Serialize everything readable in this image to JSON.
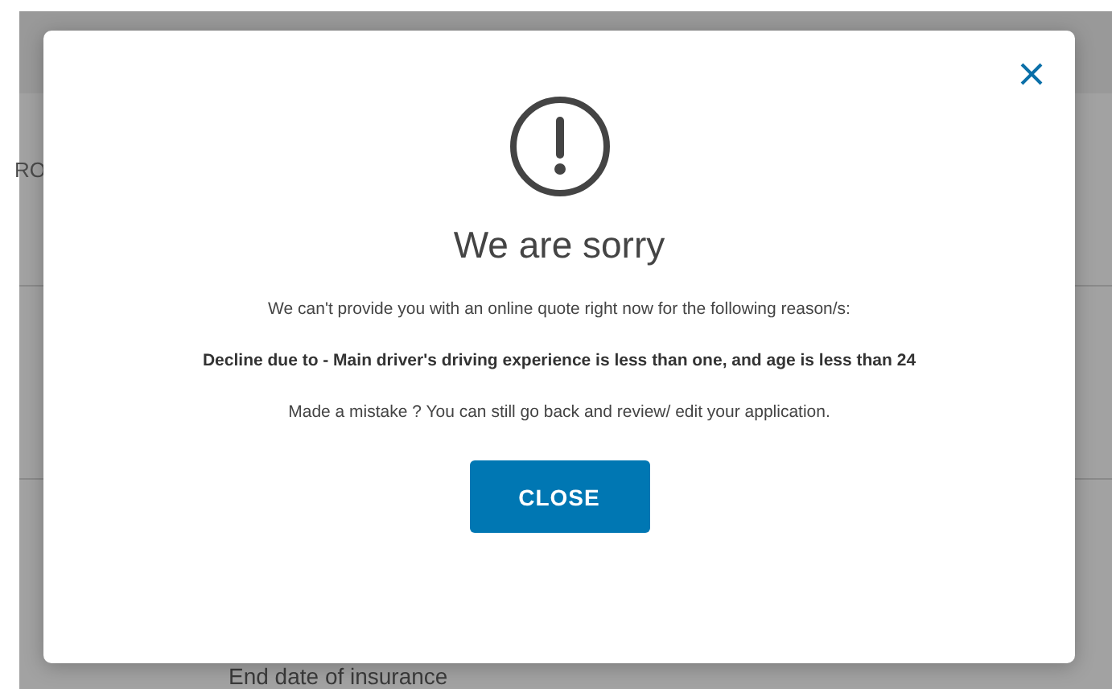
{
  "background": {
    "partial_label": "RO",
    "field_label": "End date of insurance"
  },
  "dialog": {
    "title": "We are sorry",
    "message": "We can't provide you with an online quote right now for the following reason/s:",
    "reason": "Decline due to - Main driver's driving experience is less than one, and age is less than 24",
    "hint": "Made a mistake ? You can still go back and review/ edit your application.",
    "button": "CLOSE"
  }
}
